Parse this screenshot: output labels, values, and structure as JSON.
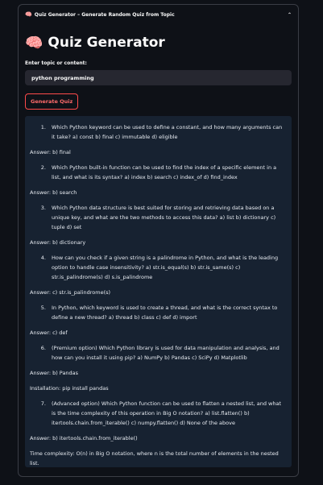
{
  "window": {
    "emoji": "🧠",
    "title": "Quiz Generator – Generate Random Quiz from Topic",
    "collapse_icon": "chevron-up-icon"
  },
  "app": {
    "emoji": "🧠",
    "title": "Quiz Generator"
  },
  "input": {
    "label": "Enter topic or content:",
    "value": "python programming"
  },
  "button": {
    "label": "Generate Quiz"
  },
  "quiz": [
    {
      "num": "1.",
      "question": "Which Python keyword can be used to define a constant, and how many arguments can it take? a) const b) final c) immutable d) eligible",
      "answers": [
        "Answer: b) final"
      ]
    },
    {
      "num": "2.",
      "question": "Which Python built-in function can be used to find the index of a specific element in a list, and what is its syntax? a) index b) search c) index_of d) find_index",
      "answers": [
        "Answer: b) search"
      ]
    },
    {
      "num": "3.",
      "question": "Which Python data structure is best suited for storing and retrieving data based on a unique key, and what are the two methods to access this data? a) list b) dictionary c) tuple d) set",
      "answers": [
        "Answer: b) dictionary"
      ]
    },
    {
      "num": "4.",
      "question": "How can you check if a given string is a palindrome in Python, and what is the leading option to handle case insensitivity? a) str.is_equal(s) b) str.is_same(s) c) str.is_palindrome(s) d) s.is_palindrome",
      "answers": [
        "Answer: c) str.is_palindrome(s)"
      ]
    },
    {
      "num": "5.",
      "question": "In Python, which keyword is used to create a thread, and what is the correct syntax to define a new thread? a) thread b) class c) def d) import",
      "answers": [
        "Answer: c) def"
      ]
    },
    {
      "num": "6.",
      "question": "(Premium option) Which Python library is used for data manipulation and analysis, and how can you install it using pip? a) NumPy b) Pandas c) SciPy d) Matplotlib",
      "answers": [
        "Answer: b) Pandas",
        "Installation: pip install pandas"
      ]
    },
    {
      "num": "7.",
      "question": "(Advanced option) Which Python function can be used to flatten a nested list, and what is the time complexity of this operation in Big O notation? a) list.flatten() b) itertools.chain.from_iterable() c) numpy.flatten() d) None of the above",
      "answers": [
        "Answer: b) itertools.chain.from_iterable()",
        "Time complexity: O(n) in Big O notation, where n is the total number of elements in the nested list."
      ]
    }
  ]
}
